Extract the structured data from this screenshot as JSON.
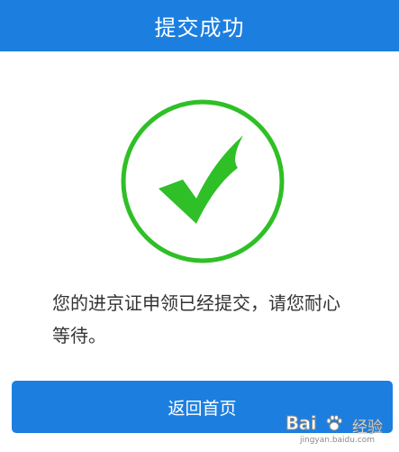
{
  "header": {
    "title": "提交成功"
  },
  "status": {
    "icon": "checkmark-circle-icon",
    "color": "#2fbf26",
    "message": "您的进京证申领已经提交，请您耐心等待。"
  },
  "actions": {
    "home_button_label": "返回首页"
  },
  "watermark": {
    "brand": "Bai",
    "suffix": "经验",
    "url": "jingyan.baidu.com"
  },
  "theme": {
    "primary": "#1c7fe0",
    "background": "#ffffff"
  }
}
